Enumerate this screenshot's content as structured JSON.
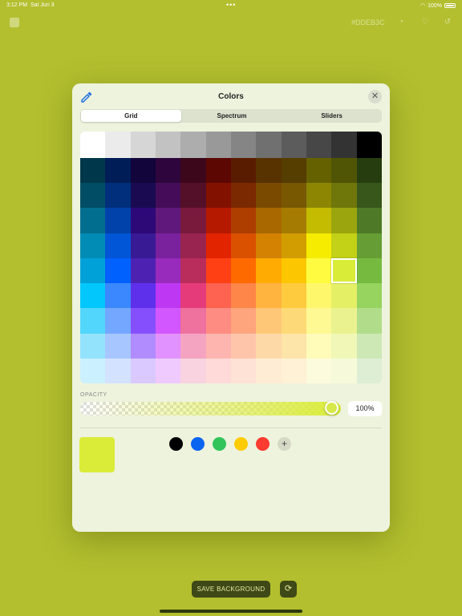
{
  "status_bar": {
    "time": "3:12 PM",
    "date": "Sat Jun 3",
    "dots": "•••",
    "battery_text": "100%"
  },
  "top_bar": {
    "hex_value": "#DDEB3C"
  },
  "panel": {
    "title": "Colors",
    "tabs": [
      {
        "label": "Grid",
        "active": true
      },
      {
        "label": "Spectrum",
        "active": false
      },
      {
        "label": "Sliders",
        "active": false
      }
    ],
    "close_glyph": "✕",
    "opacity_label": "OPACITY",
    "opacity_value": "100%",
    "opacity_fraction": 1.0,
    "current_color": "#daec38",
    "favorites": [
      "#000000",
      "#0a64f0",
      "#30c45a",
      "#ffcc00",
      "#fa3b30"
    ],
    "add_glyph": "+",
    "selected_cell": {
      "row": 5,
      "col": 10
    }
  },
  "grid_colors": [
    [
      "#ffffff",
      "#ebebeb",
      "#d6d6d6",
      "#c2c2c2",
      "#adadad",
      "#999999",
      "#858585",
      "#707070",
      "#5c5c5c",
      "#474747",
      "#333333",
      "#000000"
    ],
    [
      "#00374a",
      "#011d57",
      "#11053b",
      "#2e063d",
      "#3c071b",
      "#5c0701",
      "#5a1c00",
      "#583300",
      "#563d00",
      "#666100",
      "#4f5504",
      "#263e0f"
    ],
    [
      "#004d65",
      "#012f7b",
      "#1a0a52",
      "#450d59",
      "#551029",
      "#831100",
      "#7b2900",
      "#7a4a00",
      "#785800",
      "#8c8602",
      "#6f760a",
      "#38571a"
    ],
    [
      "#016e8f",
      "#0042a9",
      "#2c0977",
      "#61187c",
      "#791a3d",
      "#b51a00",
      "#ad3e00",
      "#a96800",
      "#a67b01",
      "#c4bc00",
      "#9ba50e",
      "#4e7a27"
    ],
    [
      "#008cb4",
      "#0056d6",
      "#371a94",
      "#7a219e",
      "#99244f",
      "#e22400",
      "#da5100",
      "#d38301",
      "#d19d01",
      "#f5ec00",
      "#c3d117",
      "#669d34"
    ],
    [
      "#00a1d8",
      "#0061fe",
      "#4d22b2",
      "#982abc",
      "#b92d5d",
      "#ff4015",
      "#ff6a00",
      "#ffab01",
      "#fcc700",
      "#fefb41",
      "#d9ec37",
      "#76bb40"
    ],
    [
      "#01c7fc",
      "#3a87fe",
      "#5e30eb",
      "#be38f3",
      "#e63b7a",
      "#fe6250",
      "#fe8648",
      "#feb43f",
      "#fecb3e",
      "#fff76b",
      "#e4ef65",
      "#96d35f"
    ],
    [
      "#52d6fc",
      "#74a7ff",
      "#864ffd",
      "#d357fe",
      "#ee719e",
      "#ff8c82",
      "#fea57d",
      "#fec777",
      "#fed977",
      "#fff994",
      "#eaf28f",
      "#b1dd8b"
    ],
    [
      "#93e3fc",
      "#a7c6ff",
      "#b18cfe",
      "#e292fe",
      "#f4a4c0",
      "#ffb5af",
      "#ffc5ab",
      "#fed9a8",
      "#fde4a8",
      "#fffbb9",
      "#f1f7b7",
      "#cde8b5"
    ],
    [
      "#cbf0ff",
      "#d3e2ff",
      "#d9c9fe",
      "#efcaff",
      "#f9d3e0",
      "#ffdad8",
      "#ffe2d6",
      "#feecd4",
      "#fef1d5",
      "#fdfbdd",
      "#f6fadb",
      "#deeed4"
    ]
  ]
}
